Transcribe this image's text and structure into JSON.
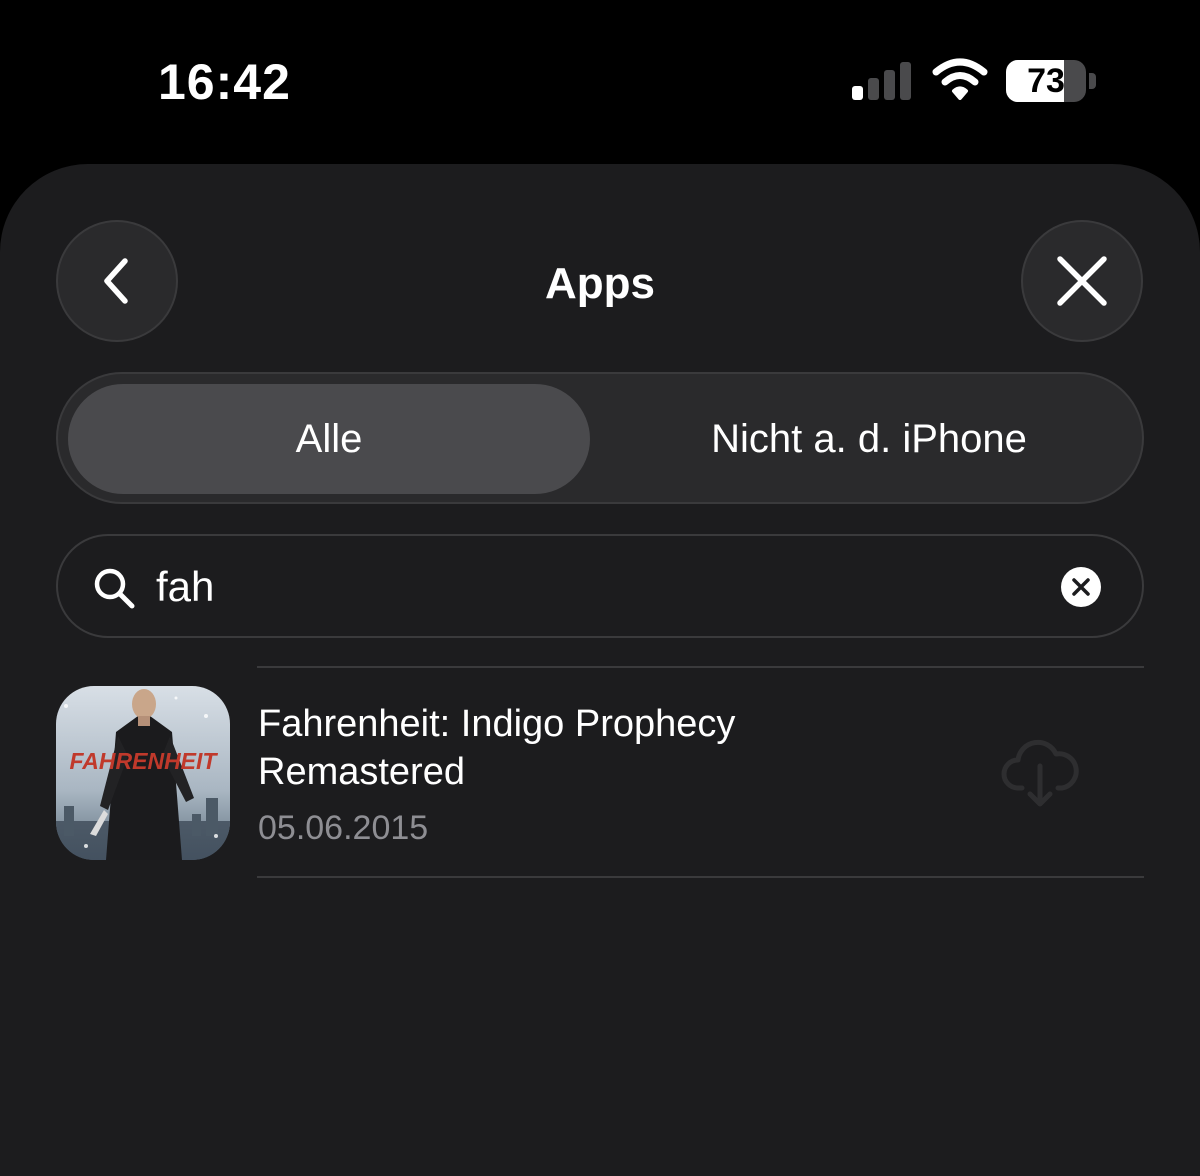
{
  "status_bar": {
    "time": "16:42",
    "battery_percent": "73",
    "battery_level": 0.73,
    "signal_bars_active": 1,
    "signal_bars_total": 4,
    "icons": [
      "cellular-signal-icon",
      "wifi-icon",
      "battery-icon"
    ]
  },
  "sheet": {
    "title": "Apps",
    "back_icon": "chevron-left-icon",
    "close_icon": "close-x-icon"
  },
  "segmented": {
    "options": [
      "Alle",
      "Nicht a. d. iPhone"
    ],
    "selected": "Alle"
  },
  "search": {
    "value": "fah",
    "icon": "search-icon",
    "clear_icon": "clear-x-icon"
  },
  "apps": [
    {
      "name": "Fahrenheit: Indigo Prophecy Remastered",
      "date": "05.06.2015",
      "icon_text": "FAHRENHEIT",
      "action_icon": "cloud-download-icon"
    }
  ],
  "colors": {
    "background": "#000000",
    "sheet": "#1c1c1e",
    "control": "#2a2a2c",
    "selected_segment": "#4a4a4d",
    "secondary_text": "#8e8e93",
    "caret": "#5b6bff",
    "icon_red": "#c0392b"
  }
}
